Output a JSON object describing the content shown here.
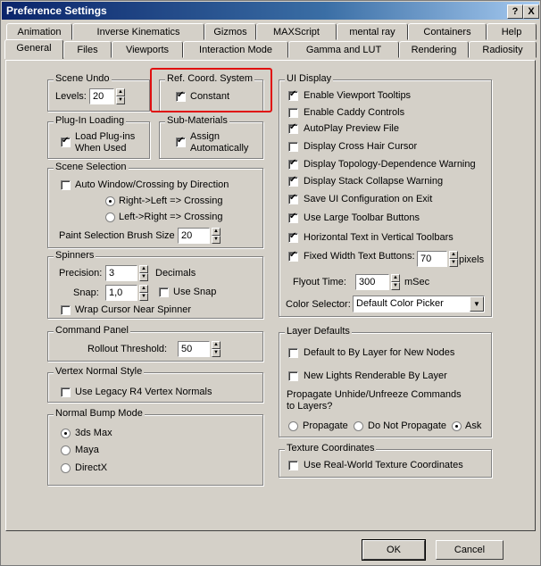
{
  "window": {
    "title": "Preference Settings",
    "help_btn": "?",
    "close_btn": "X"
  },
  "tabs_top": [
    "Animation",
    "Inverse Kinematics",
    "Gizmos",
    "MAXScript",
    "mental ray",
    "Containers",
    "Help"
  ],
  "tabs_bottom": [
    "General",
    "Files",
    "Viewports",
    "Interaction Mode",
    "Gamma and LUT",
    "Rendering",
    "Radiosity"
  ],
  "scene_undo": {
    "title": "Scene Undo",
    "levels_label": "Levels:",
    "levels_value": "20"
  },
  "ref_coord": {
    "title": "Ref. Coord. System",
    "constant_label": "Constant",
    "highlight_color": "#e01010"
  },
  "plugin_loading": {
    "title": "Plug-In Loading",
    "label_line1": "Load Plug-ins",
    "label_line2": "When Used"
  },
  "sub_materials": {
    "title": "Sub-Materials",
    "label_line1": "Assign",
    "label_line2": "Automatically"
  },
  "scene_selection": {
    "title": "Scene Selection",
    "auto_window": "Auto Window/Crossing by Direction",
    "right_left": "Right->Left => Crossing",
    "left_right": "Left->Right => Crossing",
    "paint_label": "Paint Selection Brush Size",
    "paint_value": "20"
  },
  "spinners": {
    "title": "Spinners",
    "precision_label": "Precision:",
    "precision_value": "3",
    "decimals_label": "Decimals",
    "snap_label": "Snap:",
    "snap_value": "1,0",
    "use_snap_label": "Use Snap",
    "wrap_label": "Wrap Cursor Near Spinner"
  },
  "command_panel": {
    "title": "Command Panel",
    "rollout_label": "Rollout Threshold:",
    "rollout_value": "50"
  },
  "vertex_normal": {
    "title": "Vertex Normal Style",
    "legacy_label": "Use Legacy R4 Vertex Normals"
  },
  "normal_bump": {
    "title": "Normal Bump Mode",
    "opt1": "3ds Max",
    "opt2": "Maya",
    "opt3": "DirectX"
  },
  "ui_display": {
    "title": "UI Display",
    "items": [
      "Enable Viewport Tooltips",
      "Enable Caddy Controls",
      "AutoPlay Preview File",
      "Display Cross Hair Cursor",
      "Display Topology-Dependence Warning",
      "Display Stack Collapse Warning",
      "Save UI Configuration on Exit",
      "Use Large Toolbar Buttons",
      "Horizontal Text in Vertical Toolbars",
      "Fixed Width Text Buttons:"
    ],
    "fixed_width_value": "70",
    "pixels_label": "pixels",
    "flyout_label": "Flyout Time:",
    "flyout_value": "300",
    "msec_label": "mSec",
    "color_selector_label": "Color Selector:",
    "color_selector_value": "Default Color Picker"
  },
  "layer_defaults": {
    "title": "Layer Defaults",
    "default_bylayer": "Default to By Layer for New Nodes",
    "new_lights": "New Lights Renderable By Layer",
    "propagate_line1": "Propagate Unhide/Unfreeze Commands",
    "propagate_line2": "to Layers?",
    "opt_propagate": "Propagate",
    "opt_no": "Do Not Propagate",
    "opt_ask": "Ask"
  },
  "texture_coords": {
    "title": "Texture Coordinates",
    "real_world": "Use Real-World Texture Coordinates"
  },
  "buttons": {
    "ok": "OK",
    "cancel": "Cancel"
  }
}
